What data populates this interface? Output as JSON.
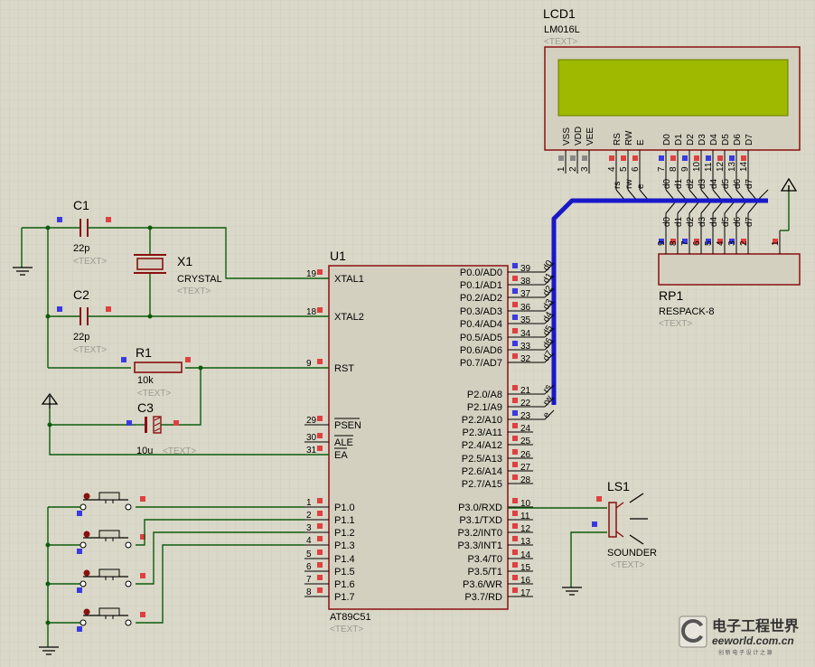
{
  "lcd": {
    "ref": "LCD1",
    "part": "LM016L",
    "tag": "<TEXT>",
    "pins": [
      "VSS",
      "VDD",
      "VEE",
      "RS",
      "RW",
      "E",
      "D0",
      "D1",
      "D2",
      "D3",
      "D4",
      "D5",
      "D6",
      "D7"
    ],
    "nums": [
      "1",
      "2",
      "3",
      "4",
      "5",
      "6",
      "7",
      "8",
      "9",
      "10",
      "11",
      "12",
      "13",
      "14"
    ],
    "nets": [
      "rs",
      "rw",
      "e",
      "d0",
      "d1",
      "d2",
      "d3",
      "d4",
      "d5",
      "d6",
      "d7"
    ]
  },
  "rp1": {
    "ref": "RP1",
    "part": "RESPACK-8",
    "tag": "<TEXT>",
    "nums": [
      "9",
      "8",
      "7",
      "6",
      "5",
      "4",
      "3",
      "2",
      "1"
    ],
    "nets": [
      "d0",
      "d1",
      "d2",
      "d3",
      "d4",
      "d5",
      "d6",
      "d7"
    ]
  },
  "c1": {
    "ref": "C1",
    "val": "22p",
    "tag": "<TEXT>"
  },
  "c2": {
    "ref": "C2",
    "val": "22p",
    "tag": "<TEXT>"
  },
  "x1": {
    "ref": "X1",
    "val": "CRYSTAL",
    "tag": "<TEXT>"
  },
  "r1": {
    "ref": "R1",
    "val": "10k",
    "tag": "<TEXT>"
  },
  "c3": {
    "ref": "C3",
    "val": "10u",
    "tag": "<TEXT>"
  },
  "u1": {
    "ref": "U1",
    "part": "AT89C51",
    "tag": "<TEXT>",
    "left": [
      {
        "n": "19",
        "l": "XTAL1"
      },
      {
        "n": "18",
        "l": "XTAL2"
      },
      {
        "n": "9",
        "l": "RST"
      },
      {
        "n": "29",
        "l": "PSEN"
      },
      {
        "n": "30",
        "l": "ALE"
      },
      {
        "n": "31",
        "l": "EA"
      },
      {
        "n": "1",
        "l": "P1.0"
      },
      {
        "n": "2",
        "l": "P1.1"
      },
      {
        "n": "3",
        "l": "P1.2"
      },
      {
        "n": "4",
        "l": "P1.3"
      },
      {
        "n": "5",
        "l": "P1.4"
      },
      {
        "n": "6",
        "l": "P1.5"
      },
      {
        "n": "7",
        "l": "P1.6"
      },
      {
        "n": "8",
        "l": "P1.7"
      }
    ],
    "right": [
      {
        "n": "39",
        "l": "P0.0/AD0"
      },
      {
        "n": "38",
        "l": "P0.1/AD1"
      },
      {
        "n": "37",
        "l": "P0.2/AD2"
      },
      {
        "n": "36",
        "l": "P0.3/AD3"
      },
      {
        "n": "35",
        "l": "P0.4/AD4"
      },
      {
        "n": "34",
        "l": "P0.5/AD5"
      },
      {
        "n": "33",
        "l": "P0.6/AD6"
      },
      {
        "n": "32",
        "l": "P0.7/AD7"
      },
      {
        "n": "21",
        "l": "P2.0/A8"
      },
      {
        "n": "22",
        "l": "P2.1/A9"
      },
      {
        "n": "23",
        "l": "P2.2/A10"
      },
      {
        "n": "24",
        "l": "P2.3/A11"
      },
      {
        "n": "25",
        "l": "P2.4/A12"
      },
      {
        "n": "26",
        "l": "P2.5/A13"
      },
      {
        "n": "27",
        "l": "P2.6/A14"
      },
      {
        "n": "28",
        "l": "P2.7/A15"
      },
      {
        "n": "10",
        "l": "P3.0/RXD"
      },
      {
        "n": "11",
        "l": "P3.1/TXD"
      },
      {
        "n": "12",
        "l": "P3.2/INT0"
      },
      {
        "n": "13",
        "l": "P3.3/INT1"
      },
      {
        "n": "14",
        "l": "P3.4/T0"
      },
      {
        "n": "15",
        "l": "P3.5/T1"
      },
      {
        "n": "16",
        "l": "P3.6/WR"
      },
      {
        "n": "17",
        "l": "P3.7/RD"
      }
    ],
    "p0nets": [
      "d0",
      "d1",
      "d2",
      "d3",
      "d4",
      "d5",
      "d6",
      "d7"
    ],
    "p2nets": [
      "rs",
      "rw",
      "e"
    ]
  },
  "ls1": {
    "ref": "LS1",
    "part": "SOUNDER",
    "tag": "<TEXT>"
  },
  "watermark": {
    "cn": "电子工程世界",
    "site": "eeworld.com.cn",
    "slogan": "创 新 电 子 设 计 之 源"
  },
  "colors": {
    "bg": "#dad8c8",
    "grid": "#c3c1b2",
    "wire": "#0d5c0d",
    "body": "#8a1010",
    "chip": "#d4d0c0",
    "lcd": "#9fb800",
    "bus": "#1818c8",
    "pinRed": "#e04040",
    "pinBlue": "#3a3ae0"
  }
}
